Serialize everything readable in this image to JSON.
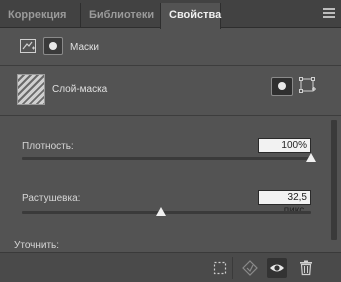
{
  "tabs": [
    {
      "label": "Коррекция"
    },
    {
      "label": "Библиотеки"
    },
    {
      "label": "Свойства"
    }
  ],
  "active_tab": "Свойства",
  "masks_label": "Маски",
  "layer": {
    "label": "Слой-маска"
  },
  "density": {
    "label": "Плотность:",
    "value": "100%",
    "slider_percent": 100
  },
  "feather": {
    "label": "Растушевка:",
    "value": "32,5 пикс.",
    "slider_percent": 48
  },
  "refine_label": "Уточнить:",
  "icons": {
    "panel_menu": "panel-menu-icon",
    "pixel_mask": "pixel-mask-icon",
    "vector_mask": "vector-mask-icon",
    "load_selection": "load-selection-icon",
    "apply_mask": "apply-mask-icon",
    "visibility": "eye-icon",
    "delete": "trash-icon"
  }
}
